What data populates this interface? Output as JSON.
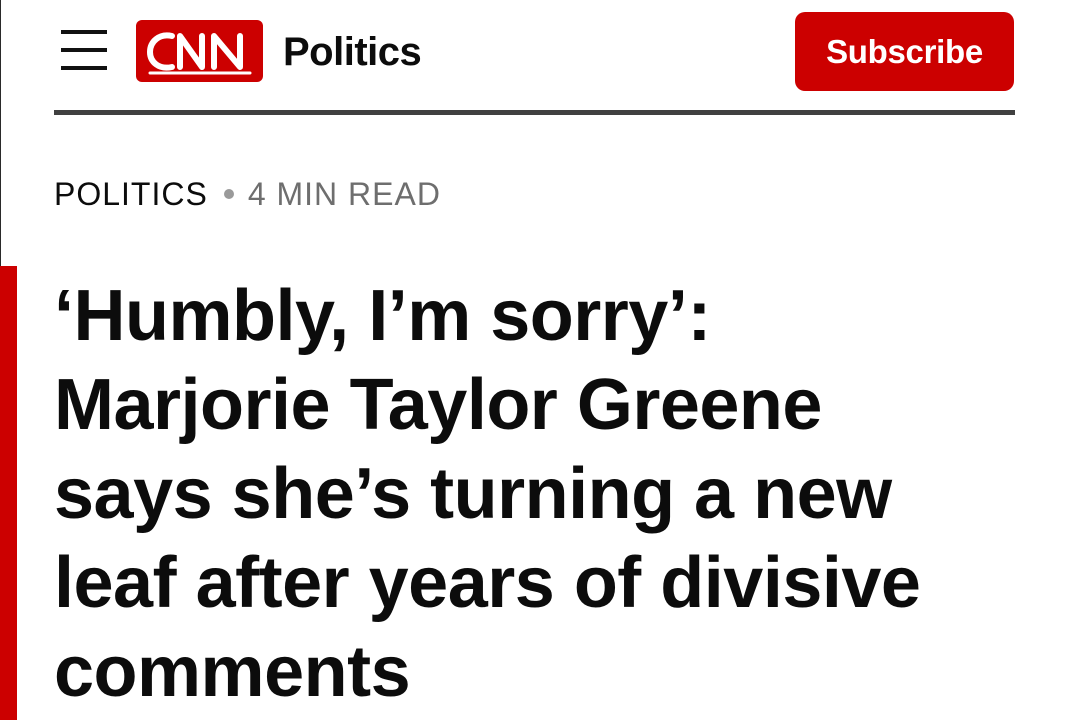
{
  "header": {
    "menu_icon": "hamburger-menu-icon",
    "brand": "CNN",
    "section": "Politics",
    "subscribe_label": "Subscribe",
    "brand_color": "#cc0000"
  },
  "article": {
    "category": "POLITICS",
    "read_time": "4 MIN READ",
    "headline_lines": [
      "‘Humbly, I’m sorry’:",
      "Marjorie Taylor Greene",
      "says she’s turning a new",
      "leaf after years of divisive",
      "comments"
    ]
  }
}
